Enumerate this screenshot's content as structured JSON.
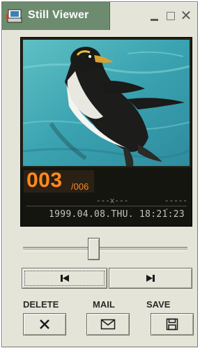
{
  "window": {
    "title": "Still Viewer",
    "icons": {
      "app": "camera-icon",
      "minimize": "minimize-icon",
      "maximize": "maximize-icon",
      "close": "close-icon"
    },
    "close_glyph": "✕"
  },
  "viewer": {
    "image_subject": "penguin-photo",
    "frame_current": "003",
    "frame_total": "/006",
    "status_mid": "---x---",
    "status_right": "------",
    "datetime": "1999.04.08.THU.  18:21:23"
  },
  "slider": {
    "position_fraction": 0.42
  },
  "navigation": {
    "prev_icon": "skip-previous-icon",
    "next_icon": "skip-next-icon"
  },
  "actions": {
    "delete_label": "DELETE",
    "mail_label": "MAIL",
    "save_label": "SAVE",
    "delete_icon": "delete-x-icon",
    "mail_icon": "envelope-icon",
    "save_icon": "floppy-disk-icon"
  },
  "colors": {
    "titlebar": "#6d8c6f",
    "counter_text": "#ff8a1e",
    "window_bg": "#e4e4d8",
    "display_bg": "#151510"
  }
}
